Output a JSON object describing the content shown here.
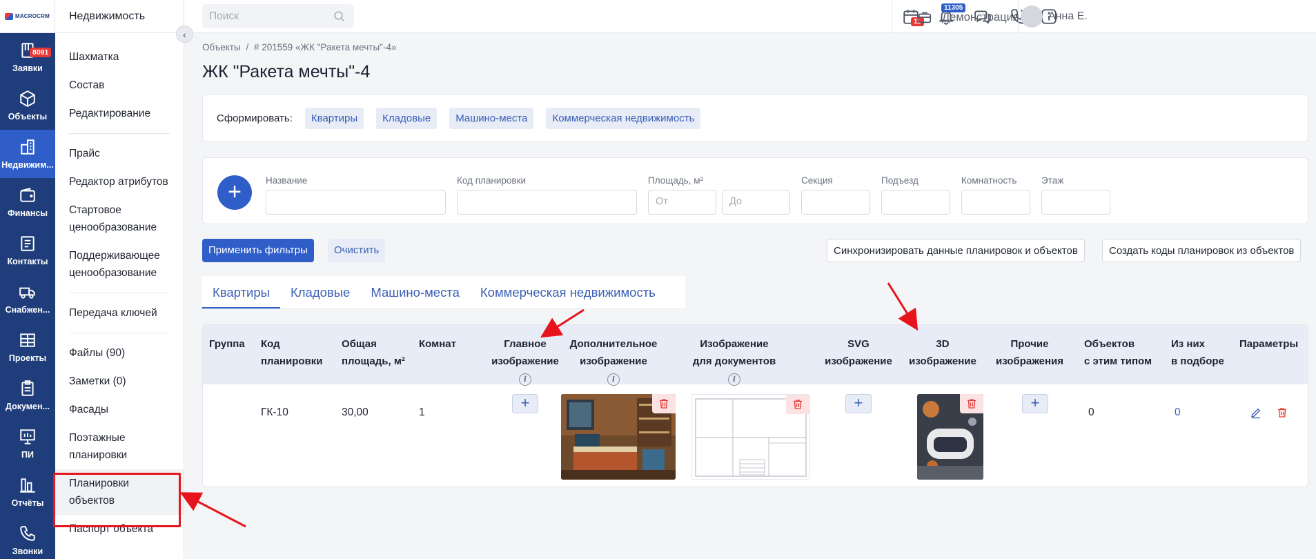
{
  "brand": {
    "logo_text": "MACROCRM"
  },
  "rail": [
    {
      "label": "Заявки",
      "icon": "applications-icon",
      "badge": "8091"
    },
    {
      "label": "Объекты",
      "icon": "cube-icon"
    },
    {
      "label": "Недвижим...",
      "icon": "building-icon",
      "active": true
    },
    {
      "label": "Финансы",
      "icon": "wallet-icon"
    },
    {
      "label": "Контакты",
      "icon": "contacts-icon"
    },
    {
      "label": "Снабжен...",
      "icon": "truck-icon"
    },
    {
      "label": "Проекты",
      "icon": "projects-icon"
    },
    {
      "label": "Докумен...",
      "icon": "clipboard-icon"
    },
    {
      "label": "ПИ",
      "icon": "presentation-icon"
    },
    {
      "label": "Отчёты",
      "icon": "bar-chart-icon"
    },
    {
      "label": "Звонки",
      "icon": "phone-icon"
    }
  ],
  "sidebar": {
    "title": "Недвижимость",
    "items": [
      {
        "label": "Шахматка"
      },
      {
        "label": "Состав"
      },
      {
        "label": "Редактирование"
      },
      {
        "sep": true
      },
      {
        "label": "Прайс"
      },
      {
        "label": "Редактор атрибутов"
      },
      {
        "label": "Стартовое ценообразование"
      },
      {
        "label": "Поддерживающее ценообразование"
      },
      {
        "sep": true
      },
      {
        "label": "Передача ключей"
      },
      {
        "sep": true
      },
      {
        "label": "Файлы (90)"
      },
      {
        "label": "Заметки (0)"
      },
      {
        "label": "Фасады"
      },
      {
        "label": "Поэтажные планировки"
      },
      {
        "label": "Планировки объектов",
        "active": true
      },
      {
        "label": "Паспорт объекта"
      }
    ]
  },
  "topbar": {
    "search_placeholder": "Поиск",
    "calendar_badge": "11",
    "notifications_badge": "11305",
    "demo_label": "Демонстрация",
    "user_name": "Анна Е."
  },
  "breadcrumb": {
    "root": "Объекты",
    "sep": "/",
    "current": "# 201559 «ЖК \"Ракета мечты\"-4»"
  },
  "page_title": "ЖК \"Ракета мечты\"-4",
  "generate": {
    "label": "Сформировать:",
    "chips": [
      "Квартиры",
      "Кладовые",
      "Машино-места",
      "Коммерческая недвижимость"
    ]
  },
  "filters": {
    "name_label": "Название",
    "code_label": "Код планировки",
    "area_label": "Площадь, м²",
    "area_from": "От",
    "area_to": "До",
    "section_label": "Секция",
    "entrance_label": "Подъезд",
    "rooms_label": "Комнатность",
    "floor_label": "Этаж"
  },
  "actions": {
    "apply": "Применить фильтры",
    "clear": "Очистить",
    "sync": "Синхронизировать данные планировок и объектов",
    "create_codes": "Создать коды планировок из объектов"
  },
  "tabs": [
    "Квартиры",
    "Кладовые",
    "Машино-места",
    "Коммерческая недвижимость"
  ],
  "table": {
    "headers": {
      "group": "Группа",
      "code_1": "Код",
      "code_2": "планировки",
      "area_1": "Общая",
      "area_2": "площадь, м²",
      "rooms": "Комнат",
      "main_1": "Главное",
      "main_2": "изображение",
      "extra_1": "Дополнительное",
      "extra_2": "изображение",
      "docs_1": "Изображение",
      "docs_2": "для документов",
      "svg_1": "SVG",
      "svg_2": "изображение",
      "td_1": "3D",
      "td_2": "изображение",
      "other_1": "Прочие",
      "other_2": "изображения",
      "count_1": "Объектов",
      "count_2": "с этим типом",
      "sel_1": "Из них",
      "sel_2": "в подборе",
      "params": "Параметры"
    },
    "row": {
      "group": "",
      "code": "ГК-10",
      "area": "30,00",
      "rooms": "1",
      "count": "0",
      "in_selection": "0"
    }
  },
  "colors": {
    "rail": "#1f3d7a",
    "accent": "#2f5ec9",
    "annotation": "#e8141b",
    "delete": "#e53935"
  }
}
